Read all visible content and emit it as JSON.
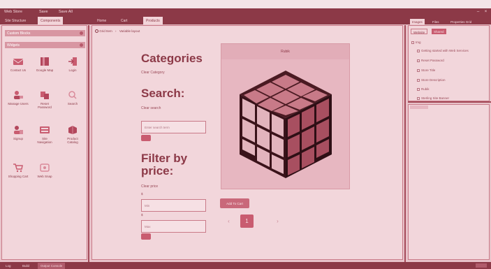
{
  "menubar": {
    "items": [
      "Web Store",
      "Save",
      "Save All"
    ],
    "window_controls": [
      "minimize-icon",
      "close-icon"
    ]
  },
  "left_tabs": [
    "Site Structure",
    "Components"
  ],
  "left_panel": {
    "section1": "Custom Blocks",
    "section2": "Widgets",
    "components": [
      {
        "label": "Contact Us",
        "icon": "contact-icon"
      },
      {
        "label": "Google Map",
        "icon": "map-icon"
      },
      {
        "label": "Login",
        "icon": "login-icon"
      },
      {
        "label": "Manage Users",
        "icon": "users-icon"
      },
      {
        "label": "Reset Password",
        "icon": "reset-icon"
      },
      {
        "label": "Search",
        "icon": "search-icon"
      },
      {
        "label": "Signup",
        "icon": "signup-icon"
      },
      {
        "label": "Site Navigation",
        "icon": "sitemap-icon"
      },
      {
        "label": "Product Catalog",
        "icon": "catalog-icon"
      },
      {
        "label": "Shopping Cart",
        "icon": "cart-icon"
      },
      {
        "label": "Web Snap",
        "icon": "snap-icon"
      }
    ]
  },
  "center_tabs": [
    "Home",
    "Cart",
    "Products"
  ],
  "breadcrumb": {
    "a": "Grid Item",
    "b": "Variable layout"
  },
  "filters": {
    "categories_title": "Categories",
    "categories_sub": "Clear Category",
    "search_title": "Search:",
    "search_sub": "Clear search",
    "search_placeholder": "Enter search term",
    "price_title": "Filter by price:",
    "price_sub": "Clear price",
    "min_label": "$",
    "min_placeholder": "Min",
    "max_label": "$",
    "max_placeholder": "Max"
  },
  "product": {
    "name": "Rubik",
    "add_button": "Add To Cart",
    "pagination": {
      "prev": "‹",
      "current": "1",
      "next": "›"
    }
  },
  "right_tabs": [
    "Images",
    "Files",
    "Properties Grid"
  ],
  "right_subtabs": [
    "Website",
    "Shared"
  ],
  "tree": {
    "root": "Img",
    "items": [
      "Getting started with Web Services",
      "Reset Password",
      "Store Title",
      "Store Description",
      "Rubik",
      "Sterling Site Banner"
    ]
  },
  "status_tabs": [
    "Log",
    "Build",
    "Output Console"
  ]
}
